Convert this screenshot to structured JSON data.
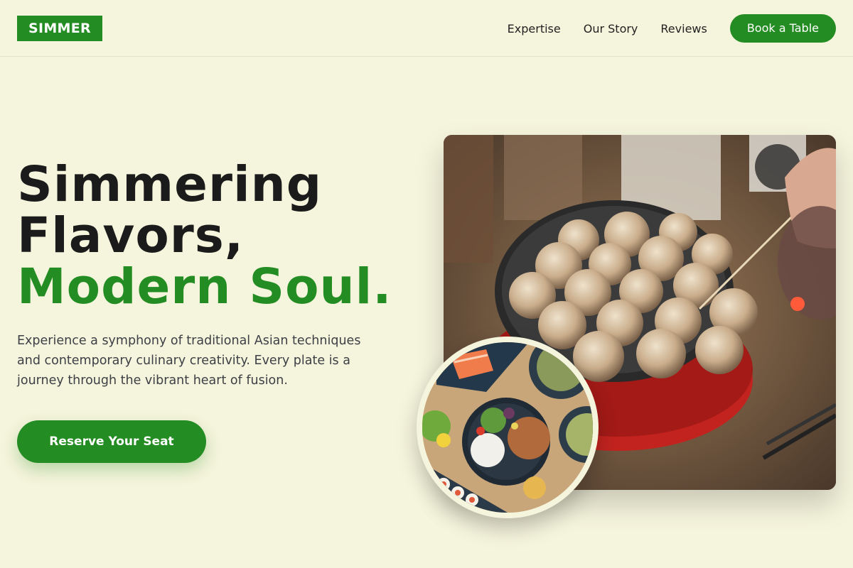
{
  "brand": {
    "name": "SIMMER",
    "accent": "#238c22",
    "background": "#f5f4dc"
  },
  "nav": {
    "links": [
      "Expertise",
      "Our Story",
      "Reviews"
    ],
    "cta": "Book a Table"
  },
  "hero": {
    "title_line1": "Simmering",
    "title_line2": "Flavors,",
    "title_accent": "Modern Soul.",
    "description": "Experience a symphony of traditional Asian techniques and contemporary culinary creativity. Every plate is a journey through the vibrant heart of fusion.",
    "cta": "Reserve Your Seat"
  },
  "images": {
    "main": "takoyaki-pan-photo",
    "inset": "fusion-bowls-photo"
  }
}
